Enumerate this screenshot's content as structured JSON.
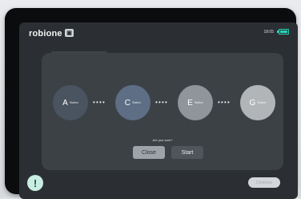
{
  "app": {
    "logo_text": "robione",
    "logo_badge_icon": "cube-icon",
    "time": "18:05"
  },
  "dialog": {
    "stations": [
      {
        "letter": "A",
        "label": "Station",
        "color": "#4a5360"
      },
      {
        "letter": "C",
        "label": "Station",
        "color": "#5d6e85"
      },
      {
        "letter": "E",
        "label": "Station",
        "color": "#8f959b"
      },
      {
        "letter": "G",
        "label": "Station",
        "color": "#b2b5b8"
      }
    ],
    "dots": "••••",
    "question": "Are you sure?",
    "close_label": "Close",
    "start_label": "Start"
  },
  "footer": {
    "alert_icon": "!",
    "confirm_label": "Continue"
  },
  "colors": {
    "accent": "#2ad3b8",
    "alert_bg": "#c9ede3"
  }
}
